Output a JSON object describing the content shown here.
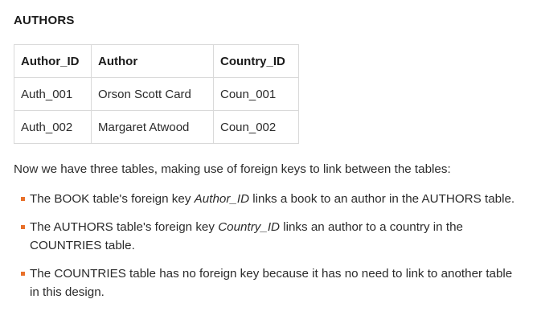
{
  "heading": "AUTHORS",
  "table": {
    "columns": [
      "Author_ID",
      "Author",
      "Country_ID"
    ],
    "rows": [
      [
        "Auth_001",
        "Orson Scott Card",
        "Coun_001"
      ],
      [
        "Auth_002",
        "Margaret Atwood",
        "Coun_002"
      ]
    ]
  },
  "intro": "Now we have three tables, making use of foreign keys to link between the tables:",
  "points": [
    {
      "before": "The BOOK table's foreign key ",
      "key": "Author_ID",
      "after": " links a book to an author in the AUTHORS table."
    },
    {
      "before": "The AUTHORS table's foreign key ",
      "key": "Country_ID",
      "after": " links an author to a country in the COUNTRIES table."
    },
    {
      "before": "The COUNTRIES table has no foreign key because it has no need to link to another table in this design.",
      "key": "",
      "after": ""
    }
  ],
  "colors": {
    "bullet": "#e8702a",
    "border": "#d9d9d9"
  }
}
